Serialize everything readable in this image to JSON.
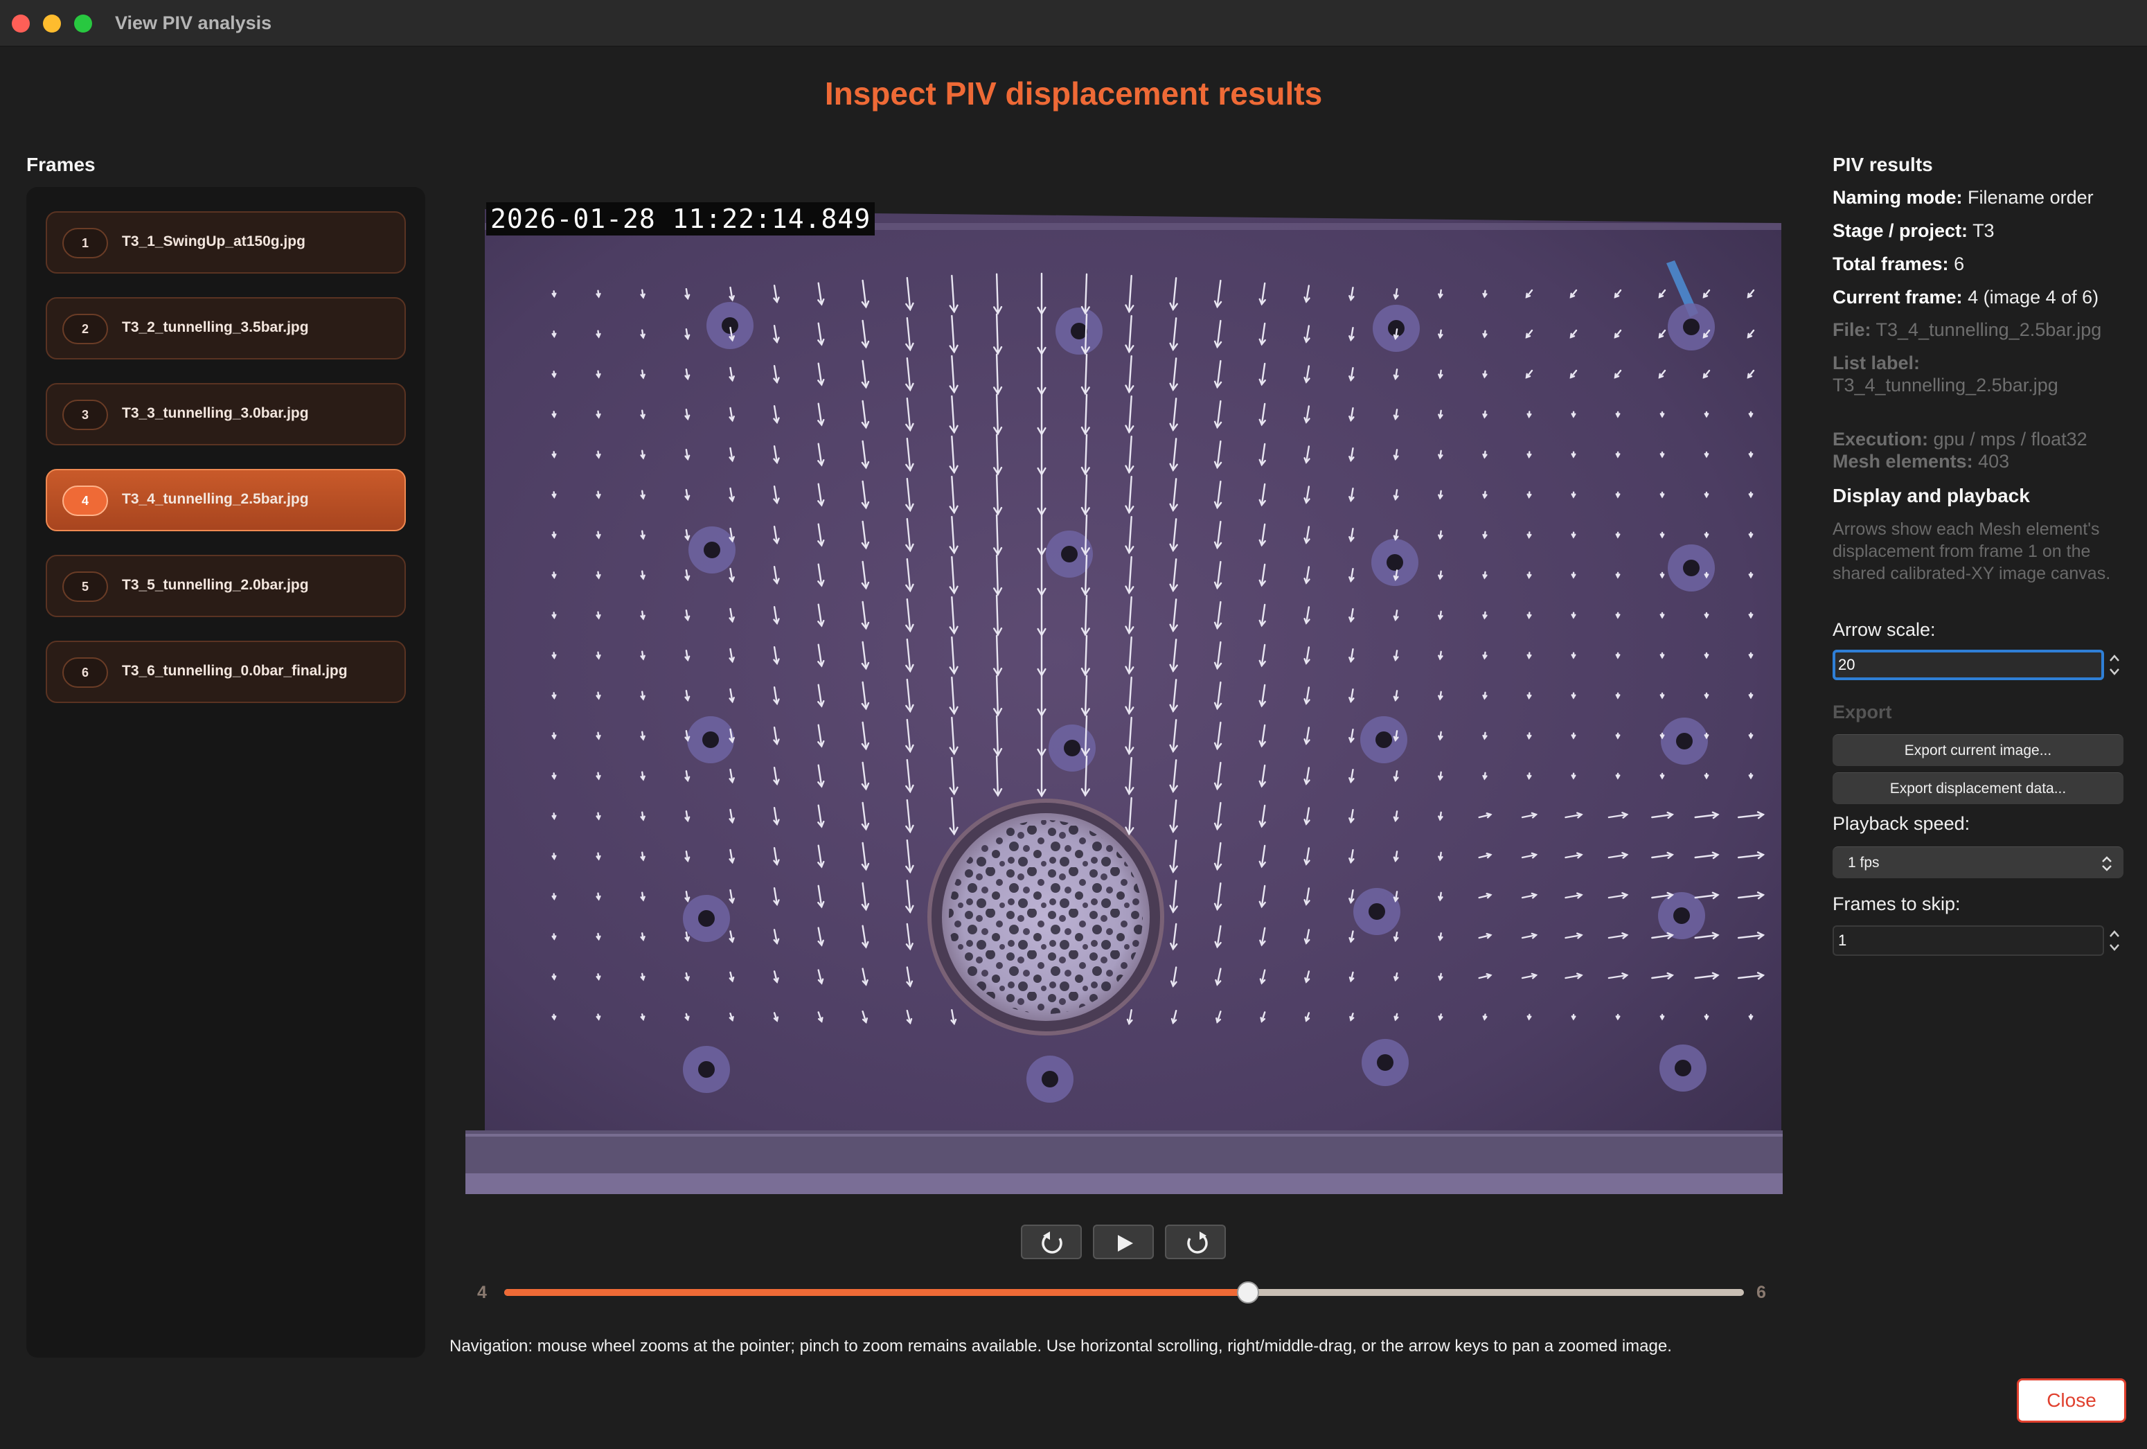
{
  "window": {
    "title": "View PIV analysis"
  },
  "page": {
    "title": "Inspect PIV displacement results"
  },
  "frames": {
    "heading": "Frames",
    "items": [
      {
        "num": "1",
        "name": "T3_1_SwingUp_at150g.jpg",
        "active": false
      },
      {
        "num": "2",
        "name": "T3_2_tunnelling_3.5bar.jpg",
        "active": false
      },
      {
        "num": "3",
        "name": "T3_3_tunnelling_3.0bar.jpg",
        "active": false
      },
      {
        "num": "4",
        "name": "T3_4_tunnelling_2.5bar.jpg",
        "active": true
      },
      {
        "num": "5",
        "name": "T3_5_tunnelling_2.0bar.jpg",
        "active": false
      },
      {
        "num": "6",
        "name": "T3_6_tunnelling_0.0bar_final.jpg",
        "active": false
      }
    ]
  },
  "viewer": {
    "timestamp": "2026-01-28 11:22:14.849"
  },
  "playback_controls": {
    "back_icon": "rotate-ccw-icon",
    "play_icon": "play-icon",
    "forward_icon": "rotate-cw-icon"
  },
  "frame_slider": {
    "min_label": "4",
    "max_label": "6",
    "fraction": 0.6
  },
  "navigation_help": "Navigation: mouse wheel zooms at the pointer; pinch to zoom remains available. Use horizontal scrolling, right/middle-drag, or the arrow keys to pan a zoomed image.",
  "results": {
    "heading": "PIV results",
    "naming_mode_label": "Naming mode:",
    "naming_mode_value": "Filename order",
    "stage_label": "Stage / project:",
    "stage_value": "T3",
    "total_frames_label": "Total frames:",
    "total_frames_value": "6",
    "current_frame_label": "Current frame:",
    "current_frame_value": "4 (image 4 of 6)",
    "file_label": "File:",
    "file_value": "T3_4_tunnelling_2.5bar.jpg",
    "list_label_label": "List label:",
    "list_label_value": "T3_4_tunnelling_2.5bar.jpg",
    "execution_label": "Execution:",
    "execution_value": "gpu / mps / float32",
    "mesh_label": "Mesh elements:",
    "mesh_value": "403"
  },
  "display": {
    "heading": "Display and playback",
    "description": "Arrows show each Mesh element's displacement from frame 1 on the shared calibrated-XY image canvas.",
    "arrow_scale_label": "Arrow scale:",
    "arrow_scale_value": "20"
  },
  "export": {
    "heading": "Export",
    "current_image_label": "Export current image...",
    "displacement_data_label": "Export displacement data..."
  },
  "playback": {
    "speed_label": "Playback speed:",
    "speed_value": "1 fps",
    "skip_label": "Frames to skip:",
    "skip_value": "1"
  },
  "close_label": "Close",
  "colors": {
    "accent": "#ef6a36",
    "background": "#1e1e1e",
    "close": "#e0402e",
    "focus": "#2f7fd6"
  }
}
